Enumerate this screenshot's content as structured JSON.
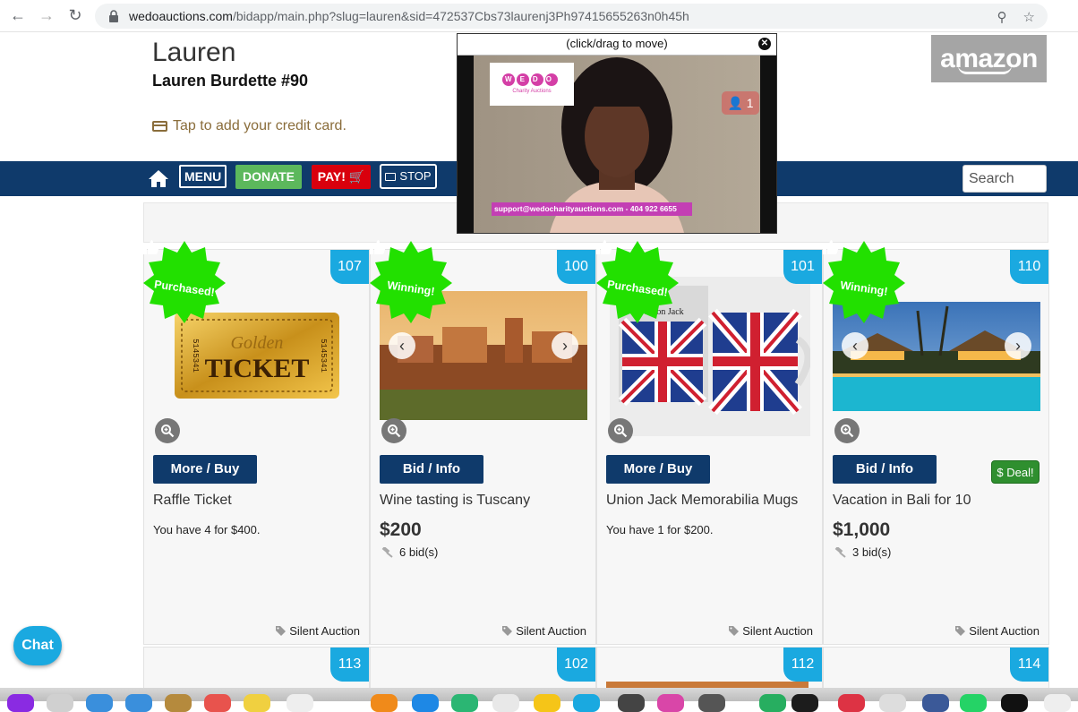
{
  "browser": {
    "url_host": "wedoauctions.com",
    "url_path": "/bidapp/main.php?slug=lauren&sid=472537Cbs73laurenj3Ph97415655263n0h45h"
  },
  "header": {
    "first_name": "Lauren",
    "full_name": "Lauren Burdette #90",
    "credit_card_link": "Tap to add your credit card.",
    "sponsor": "amazon"
  },
  "nav": {
    "menu": "MENU",
    "donate": "DONATE",
    "pay": "PAY!",
    "stop": "STOP",
    "search_placeholder": "Search"
  },
  "video": {
    "header": "(click/drag to move)",
    "viewers": "1",
    "logo_text": "WEDO",
    "logo_sub": "Charity Auctions",
    "support": "support@wedocharityauctions.com - 404 922 6655"
  },
  "cards": [
    {
      "id": "107",
      "badge": "Purchased!",
      "button": "More / Buy",
      "title": "Raffle Ticket",
      "note": "You have 4 for $400.",
      "type": "Silent Auction",
      "ticket_word1": "Golden",
      "ticket_word2": "TICKET",
      "ticket_serial": "5145341"
    },
    {
      "id": "100",
      "badge": "Winning!",
      "button": "Bid / Info",
      "title": "Wine tasting is Tuscany",
      "price": "$200",
      "bids": "6 bid(s)",
      "type": "Silent Auction"
    },
    {
      "id": "101",
      "badge": "Purchased!",
      "button": "More / Buy",
      "title": "Union Jack Memorabilia Mugs",
      "note": "You have 1 for $200.",
      "type": "Silent Auction",
      "box_label": "Union Jack"
    },
    {
      "id": "110",
      "badge": "Winning!",
      "button": "Bid / Info",
      "title": "Vacation in Bali for 10",
      "price": "$1,000",
      "bids": "3 bid(s)",
      "type": "Silent Auction",
      "deal": "Deal!"
    }
  ],
  "row2_ids": [
    "113",
    "102",
    "112",
    "114"
  ],
  "chat": "Chat",
  "colors": {
    "navy": "#0f3a6b",
    "accent_blue": "#1aa9e0",
    "donate_green": "#5cb85c",
    "pay_red": "#d9000d",
    "badge_green": "#22e000"
  }
}
